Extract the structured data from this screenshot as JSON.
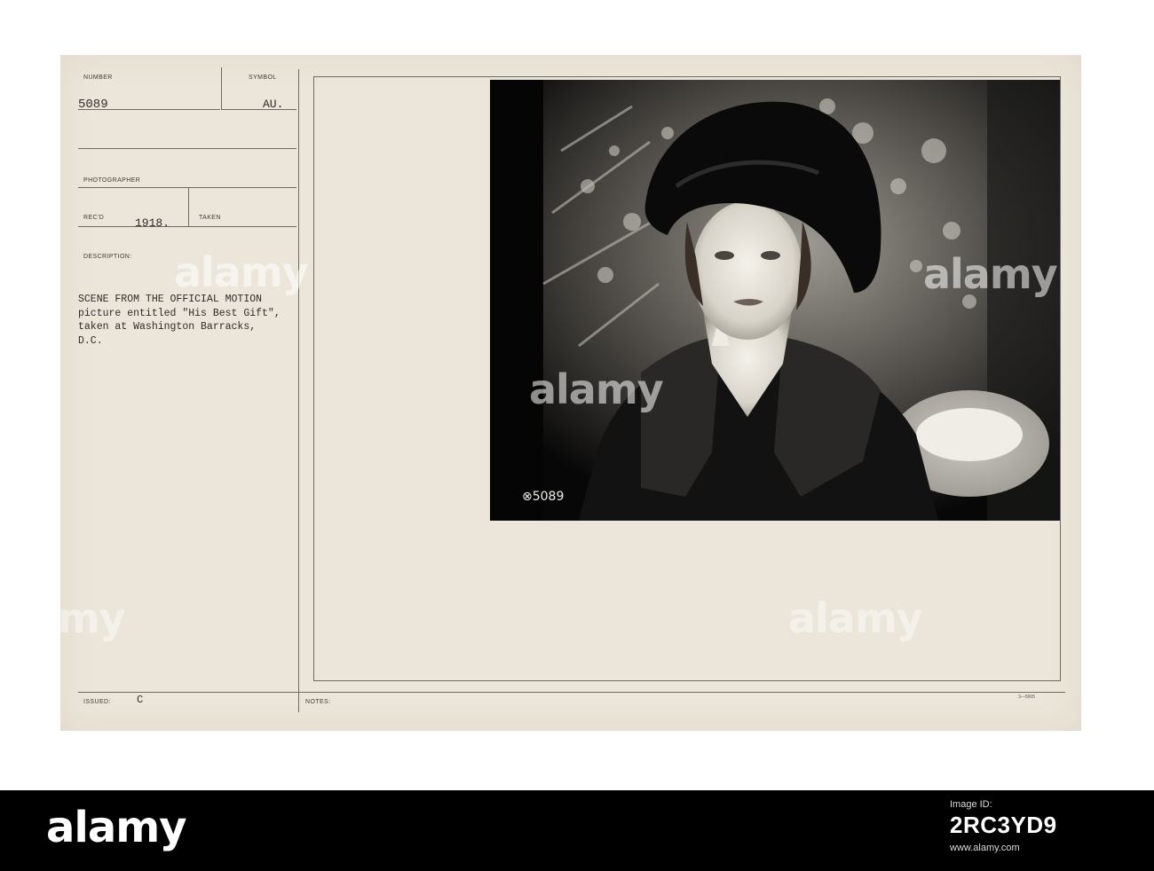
{
  "record": {
    "number_label": "NUMBER",
    "number": "5089",
    "symbol_label": "SYMBOL",
    "symbol": "AU.",
    "photographer_label": "PHOTOGRAPHER",
    "recd_label": "REC'D",
    "recd_year": "1918.",
    "taken_label": "TAKEN",
    "description_label": "DESCRIPTION:",
    "description_lines": [
      "SCENE FROM THE OFFICIAL MOTION",
      "picture entitled \"His Best Gift\",",
      "taken at Washington Barracks,",
      "D.C."
    ],
    "issued_label": "ISSUED:",
    "issued": "C",
    "notes_label": "NOTES:",
    "form_code": "3—5005"
  },
  "photo": {
    "caption_number": "⊗5089"
  },
  "watermark": {
    "text": "alamy"
  },
  "stock_banner": {
    "brand": "alamy",
    "image_id_label": "Image ID:",
    "image_id": "2RC3YD9",
    "url": "www.alamy.com"
  },
  "colors": {
    "card": "#ece6da",
    "banner": "#000000",
    "ink": "#2e2c29"
  }
}
